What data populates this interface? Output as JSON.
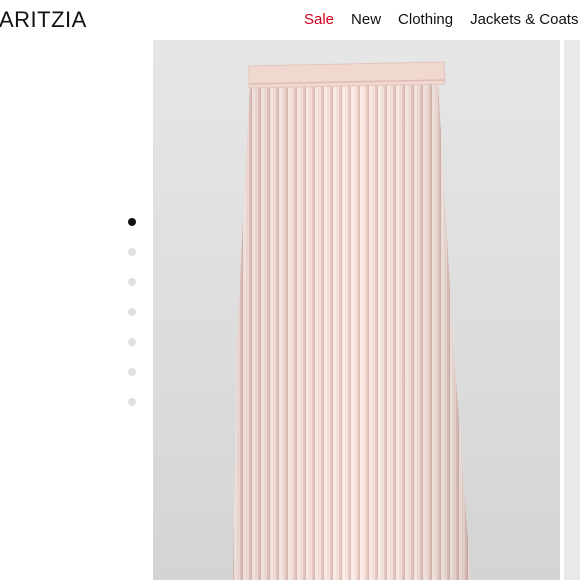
{
  "brand": {
    "logo_text": "ARITZIA"
  },
  "nav": {
    "items": [
      {
        "label": "Sale",
        "accent": "#d0021b"
      },
      {
        "label": "New"
      },
      {
        "label": "Clothing"
      },
      {
        "label": "Jackets & Coats"
      }
    ]
  },
  "gallery": {
    "image_count": 7,
    "active_index": 0,
    "product_image": "pleated-midi-skirt-photo",
    "skirt_color": "#f3d9d2"
  }
}
